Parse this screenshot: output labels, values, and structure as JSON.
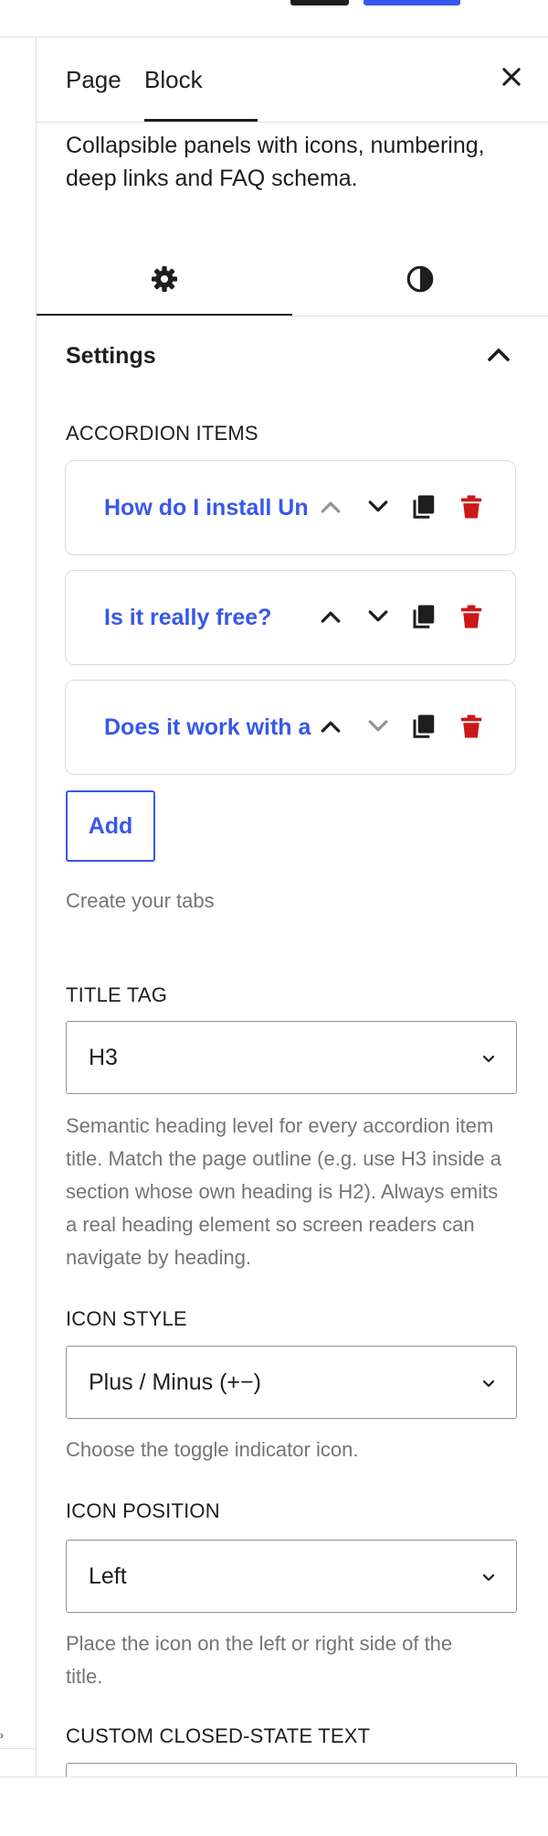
{
  "header": {
    "tabs": [
      {
        "label": "Page"
      },
      {
        "label": "Block"
      }
    ],
    "active_tab": "Block",
    "close_icon": "close-icon"
  },
  "block": {
    "description": "Collapsible panels with icons, numbering, deep links and FAQ schema."
  },
  "subtabs": {
    "items": [
      {
        "icon": "gear-icon"
      },
      {
        "icon": "contrast-icon"
      }
    ],
    "active": "gear-icon"
  },
  "settings_panel": {
    "title": "Settings",
    "expanded": true
  },
  "accordion_items": {
    "label": "ACCORDION ITEMS",
    "items": [
      {
        "title": "How do I install Un",
        "up_enabled": false,
        "down_enabled": true
      },
      {
        "title": "Is it really free?",
        "up_enabled": true,
        "down_enabled": true
      },
      {
        "title": "Does it work with a",
        "up_enabled": true,
        "down_enabled": false
      }
    ],
    "add_label": "Add",
    "help": "Create your tabs"
  },
  "title_tag": {
    "label": "TITLE TAG",
    "value": "H3",
    "help": "Semantic heading level for every accordion item title. Match the page outline (e.g. use H3 inside a section whose own heading is H2). Always emits a real heading element so screen readers can navigate by heading."
  },
  "icon_style": {
    "label": "ICON STYLE",
    "value": "Plus / Minus (+−)",
    "help": "Choose the toggle indicator icon."
  },
  "icon_position": {
    "label": "ICON POSITION",
    "value": "Left",
    "help": "Place the icon on the left or right side of the title."
  },
  "custom_closed_text": {
    "label": "CUSTOM CLOSED-STATE TEXT",
    "value": "+"
  },
  "colors": {
    "accent": "#3858e9",
    "delete": "#cc1818",
    "text": "#1e1e1e",
    "muted": "#757575",
    "border": "#dcdcde",
    "disabled_icon": "#949494"
  }
}
